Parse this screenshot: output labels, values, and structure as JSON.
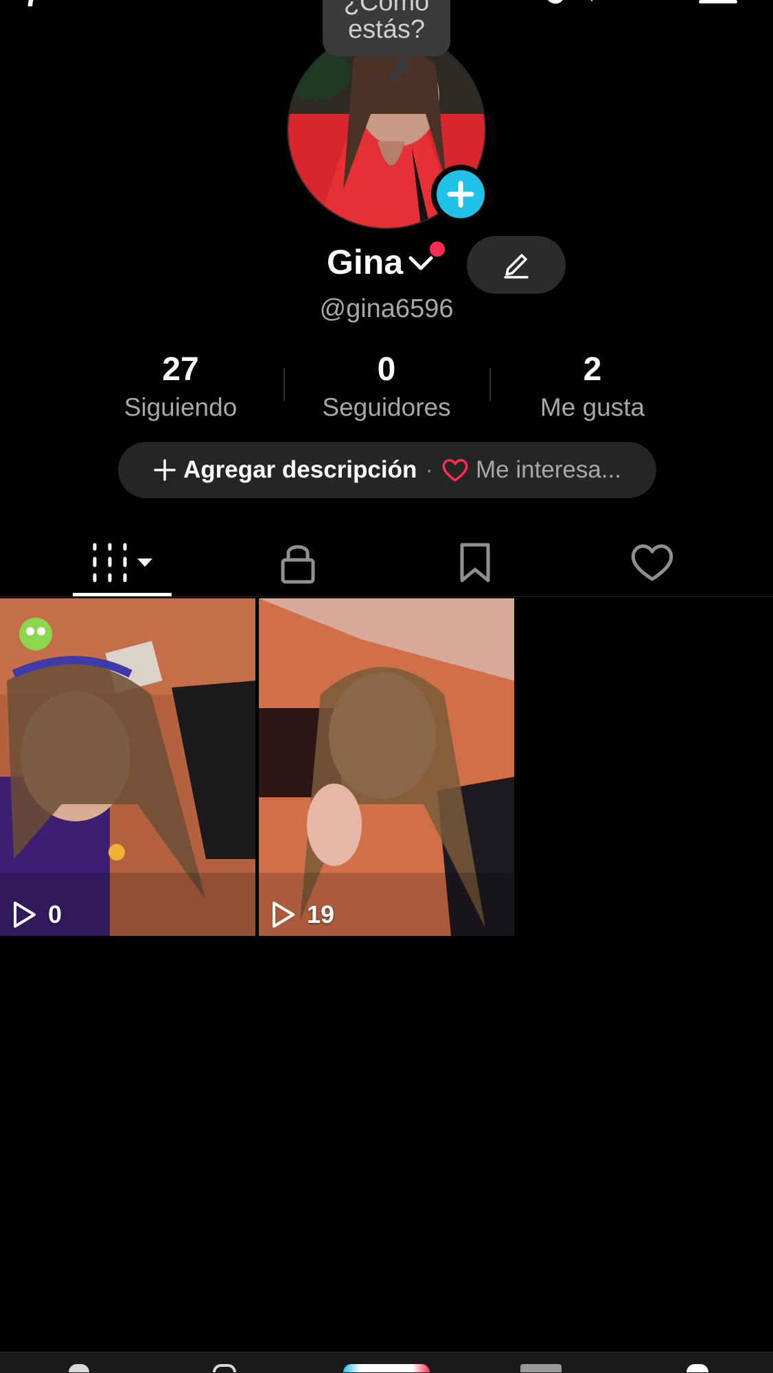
{
  "status_bubble": {
    "line1": "¿Cómo",
    "line2": "estás?"
  },
  "profile": {
    "name": "Gina",
    "handle": "@gina6596"
  },
  "stats": [
    {
      "value": "27",
      "label": "Siguiendo"
    },
    {
      "value": "0",
      "label": "Seguidores"
    },
    {
      "value": "2",
      "label": "Me gusta"
    }
  ],
  "description": {
    "add_label": "Agregar descripción",
    "separator": "·",
    "interest_label": "Me interesa..."
  },
  "tabs": [
    {
      "icon": "videos-grid-icon",
      "active": true
    },
    {
      "icon": "lock-icon",
      "active": false
    },
    {
      "icon": "bookmark-icon",
      "active": false
    },
    {
      "icon": "heart-icon",
      "active": false
    }
  ],
  "videos": [
    {
      "views": "0"
    },
    {
      "views": "19"
    }
  ],
  "colors": {
    "accent_plus": "#20c2e8",
    "notification": "#fe2c55",
    "pill_bg": "#252525"
  }
}
